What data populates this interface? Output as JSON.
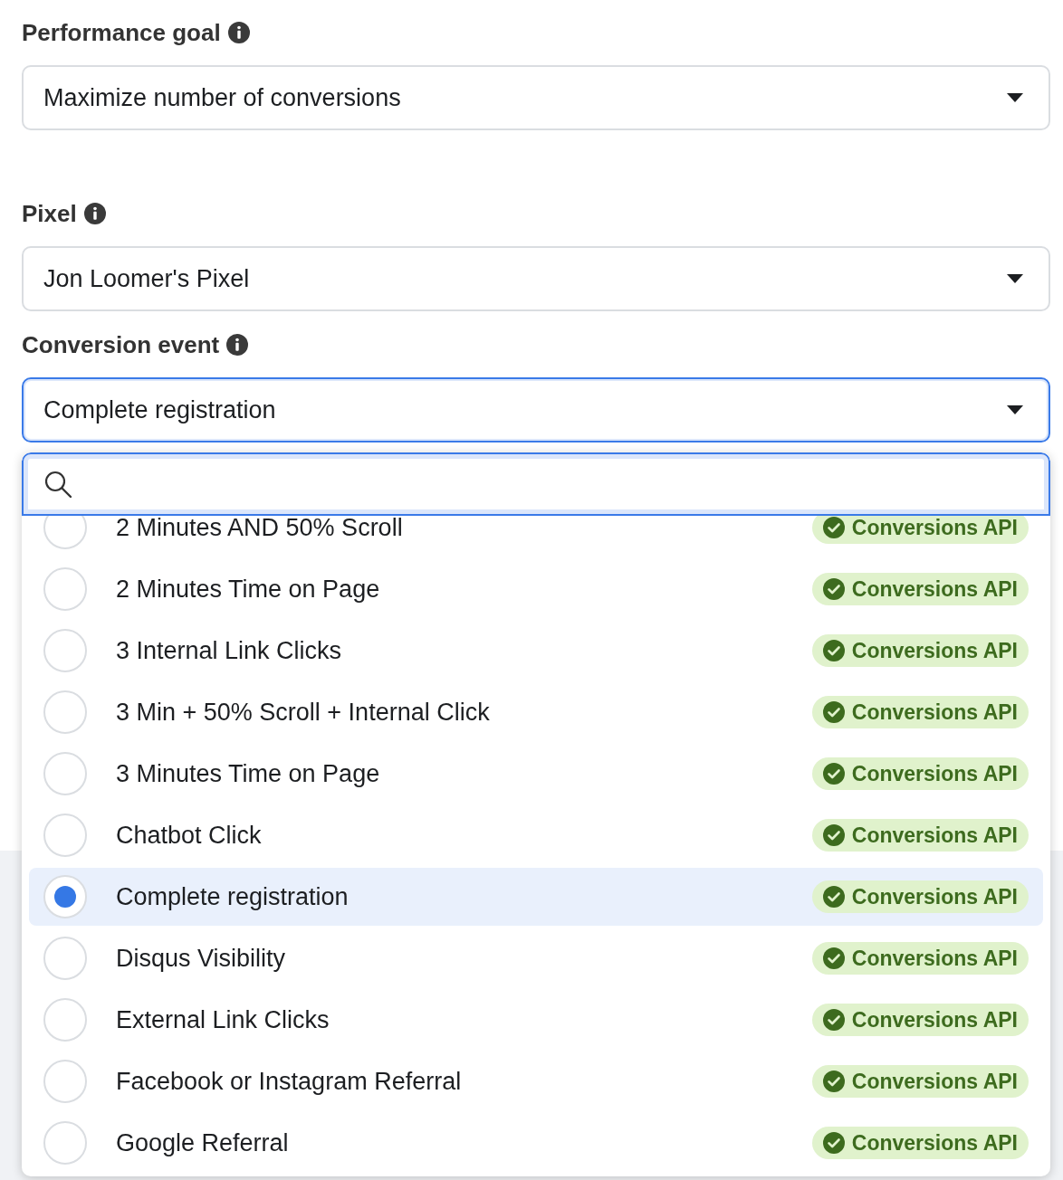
{
  "fields": [
    {
      "label": "Performance goal",
      "value": "Maximize number of conversions",
      "focused": false
    },
    {
      "label": "Pixel",
      "value": "Jon Loomer's Pixel",
      "focused": false
    },
    {
      "label": "Conversion event",
      "value": "Complete registration",
      "focused": true
    }
  ],
  "dropdown": {
    "items": [
      {
        "label": "2 Minutes AND 50% Scroll",
        "selected": false,
        "badge": "Conversions API"
      },
      {
        "label": "2 Minutes Time on Page",
        "selected": false,
        "badge": "Conversions API"
      },
      {
        "label": "3 Internal Link Clicks",
        "selected": false,
        "badge": "Conversions API"
      },
      {
        "label": "3 Min + 50% Scroll + Internal Click",
        "selected": false,
        "badge": "Conversions API"
      },
      {
        "label": "3 Minutes Time on Page",
        "selected": false,
        "badge": "Conversions API"
      },
      {
        "label": "Chatbot Click",
        "selected": false,
        "badge": "Conversions API"
      },
      {
        "label": "Complete registration",
        "selected": true,
        "badge": "Conversions API"
      },
      {
        "label": "Disqus Visibility",
        "selected": false,
        "badge": "Conversions API"
      },
      {
        "label": "External Link Clicks",
        "selected": false,
        "badge": "Conversions API"
      },
      {
        "label": "Facebook or Instagram Referral",
        "selected": false,
        "badge": "Conversions API"
      },
      {
        "label": "Google Referral",
        "selected": false,
        "badge": "Conversions API"
      }
    ]
  }
}
